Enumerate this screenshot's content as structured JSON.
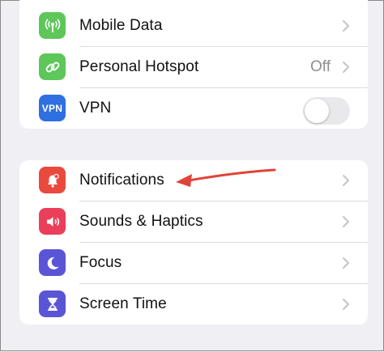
{
  "colors": {
    "mobile_data_icon": "#5fc65a",
    "hotspot_icon": "#5fc65a",
    "vpn_icon": "#2f6fe0",
    "notifications_icon": "#ea4a3d",
    "sounds_icon": "#ea3e5a",
    "focus_icon": "#5a55d6",
    "screen_time_icon": "#5a55d6",
    "annotation_arrow": "#e0443a"
  },
  "connectivity": {
    "mobile_data": {
      "label": "Mobile Data",
      "icon": "antenna-icon"
    },
    "personal_hotspot": {
      "label": "Personal Hotspot",
      "value": "Off",
      "icon": "hotspot-link-icon"
    },
    "vpn": {
      "label": "VPN",
      "icon_text": "VPN",
      "toggle_on": false
    }
  },
  "system": {
    "notifications": {
      "label": "Notifications",
      "icon": "bell-icon"
    },
    "sounds": {
      "label": "Sounds & Haptics",
      "icon": "speaker-icon"
    },
    "focus": {
      "label": "Focus",
      "icon": "moon-icon"
    },
    "screen_time": {
      "label": "Screen Time",
      "icon": "hourglass-icon"
    }
  }
}
